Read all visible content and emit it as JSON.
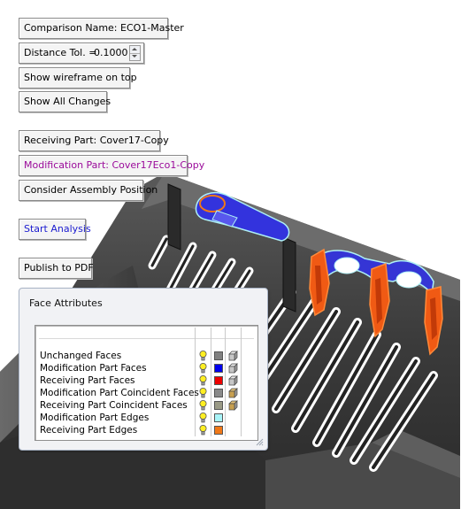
{
  "controls": {
    "comparison_name": "Comparison Name: ECO1-Master",
    "distance_tol_label": "Distance Tol. =",
    "distance_tol_value": "0.1000",
    "show_wireframe": "Show wireframe on top",
    "show_all_changes": "Show All Changes",
    "receiving_part": "Receiving Part: Cover17-Copy",
    "modification_part": "Modification Part: Cover17Eco1-Copy",
    "consider_assembly": "Consider Assembly Position",
    "start_analysis": "Start Analysis",
    "publish_pdf": "Publish to PDF"
  },
  "face_attributes": {
    "title": "Face Attributes",
    "rows": [
      {
        "label": "Unchanged Faces",
        "color": "#808080",
        "cube": "gray"
      },
      {
        "label": "Modification Part Faces",
        "color": "#0000ee",
        "cube": "gray"
      },
      {
        "label": "Receiving Part Faces",
        "color": "#ee0000",
        "cube": "gray"
      },
      {
        "label": "Modification Part Coincident Faces",
        "color": "#8a8a8a",
        "cube": "tan"
      },
      {
        "label": "Receiving  Part Coincident Faces",
        "color": "#9a9a86",
        "cube": "tan"
      },
      {
        "label": "Modification Part Edges",
        "color": "#a8f4f8",
        "cube": ""
      },
      {
        "label": "Receiving  Part Edges",
        "color": "#f07818",
        "cube": ""
      }
    ]
  },
  "colors": {
    "modification_highlight": "#3333dd",
    "receiving_highlight": "#f05a14",
    "part_body": "#3c3c3c"
  }
}
